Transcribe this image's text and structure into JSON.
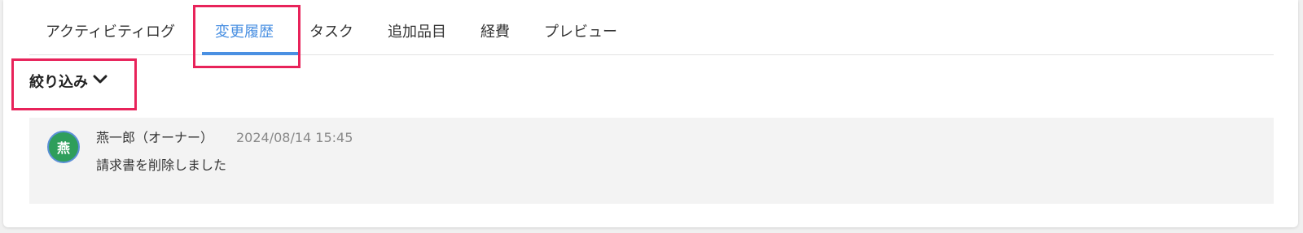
{
  "tabs": [
    {
      "label": "アクティビティログ",
      "active": false
    },
    {
      "label": "変更履歴",
      "active": true
    },
    {
      "label": "タスク",
      "active": false
    },
    {
      "label": "追加品目",
      "active": false
    },
    {
      "label": "経費",
      "active": false
    },
    {
      "label": "プレビュー",
      "active": false
    }
  ],
  "filter": {
    "label": "絞り込み",
    "icon": "chevron-down-icon"
  },
  "history": [
    {
      "avatar_initial": "燕",
      "author": "燕一郎（オーナー）",
      "timestamp": "2024/08/14 15:45",
      "message": "請求書を削除しました"
    }
  ],
  "colors": {
    "accent": "#4a90e2",
    "highlight": "#e8235a",
    "avatar_bg": "#2e9e5b"
  }
}
